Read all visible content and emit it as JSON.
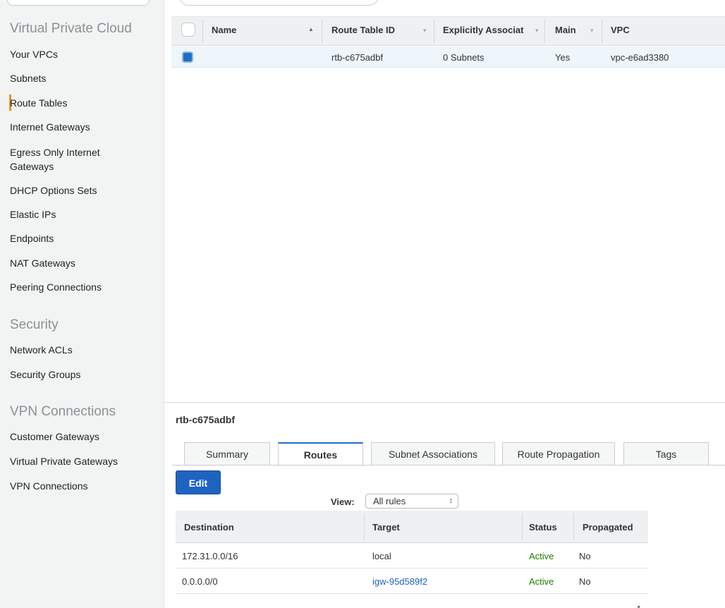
{
  "sidebar": {
    "sections": [
      {
        "title": "Virtual Private Cloud"
      },
      {
        "title": "Security"
      },
      {
        "title": "VPN Connections"
      }
    ],
    "vpc_items": [
      "Your VPCs",
      "Subnets",
      "Route Tables",
      "Internet Gateways",
      "Egress Only Internet",
      "Gateways",
      "DHCP Options Sets",
      "Elastic IPs",
      "Endpoints",
      "NAT Gateways",
      "Peering Connections"
    ],
    "security_items": [
      "Network ACLs",
      "Security Groups"
    ],
    "vpn_items": [
      "Customer Gateways",
      "Virtual Private Gateways",
      "VPN Connections"
    ],
    "active_item": "Route Tables",
    "active_color": "#e7931a"
  },
  "grid": {
    "columns": [
      "Name",
      "Route Table ID",
      "Explicitly Associat",
      "Main",
      "VPC"
    ],
    "rows": [
      {
        "name": "",
        "route_table_id": "rtb-c675adbf",
        "explicitly_associated": "0 Subnets",
        "main": "Yes",
        "vpc": "vpc-e6ad3380",
        "selected": true
      }
    ]
  },
  "detail": {
    "title": "rtb-c675adbf",
    "tabs": [
      "Summary",
      "Routes",
      "Subnet Associations",
      "Route Propagation",
      "Tags"
    ],
    "active_tab": "Routes",
    "edit_label": "Edit",
    "view_label": "View:",
    "view_value": "All rules",
    "routes_columns": [
      "Destination",
      "Target",
      "Status",
      "Propagated"
    ],
    "routes": [
      {
        "destination": "172.31.0.0/16",
        "target": "local",
        "status": "Active",
        "propagated": "No"
      },
      {
        "destination": "0.0.0.0/0",
        "target": "igw-95d589f2",
        "status": "Active",
        "propagated": "No"
      }
    ]
  },
  "colors": {
    "link": "#1f63c0",
    "status_active": "#1d8102",
    "primary_button": "#1f63c0"
  },
  "icons": {
    "sort_asc": "triangle-up",
    "sort_desc": "triangle-down",
    "select_updown": "updown-arrows"
  }
}
